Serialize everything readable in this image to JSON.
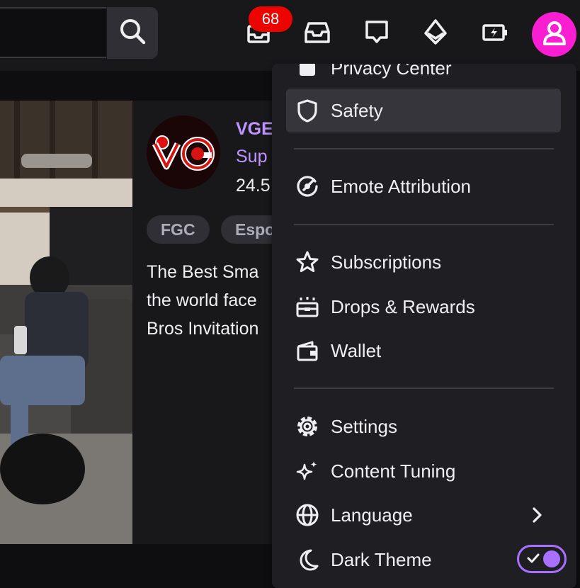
{
  "header": {
    "search": {
      "value": "",
      "placeholder": ""
    },
    "notifications_badge": "68",
    "icons": [
      "search-icon",
      "notifications-icon",
      "inbox-icon",
      "whispers-icon",
      "prime-icon",
      "bits-icon",
      "user-avatar-icon"
    ],
    "brand_colors": {
      "badge": "#eb0400",
      "avatar": "#fa1ed2",
      "accent": "#bf94ff"
    }
  },
  "stream_card": {
    "channel_name": "VGE",
    "game": "Sup",
    "viewers": "24.5",
    "tags": [
      "FGC",
      "Espo"
    ],
    "description_lines": [
      "The Best Sma",
      "the world face",
      "Bros Invitation"
    ]
  },
  "menu": {
    "items": [
      {
        "label": "Privacy Center",
        "icon": "privacy-icon"
      },
      {
        "label": "Safety",
        "icon": "shield-icon"
      },
      {
        "label": "Emote Attribution",
        "icon": "emote-attribution-icon"
      },
      {
        "label": "Subscriptions",
        "icon": "star-icon"
      },
      {
        "label": "Drops & Rewards",
        "icon": "drops-icon"
      },
      {
        "label": "Wallet",
        "icon": "wallet-icon"
      },
      {
        "label": "Settings",
        "icon": "gear-icon"
      },
      {
        "label": "Content Tuning",
        "icon": "sparkle-icon"
      },
      {
        "label": "Language",
        "icon": "globe-icon"
      },
      {
        "label": "Dark Theme",
        "icon": "moon-icon"
      }
    ],
    "dark_theme_enabled": true,
    "toggle_color": "#a970ff"
  }
}
